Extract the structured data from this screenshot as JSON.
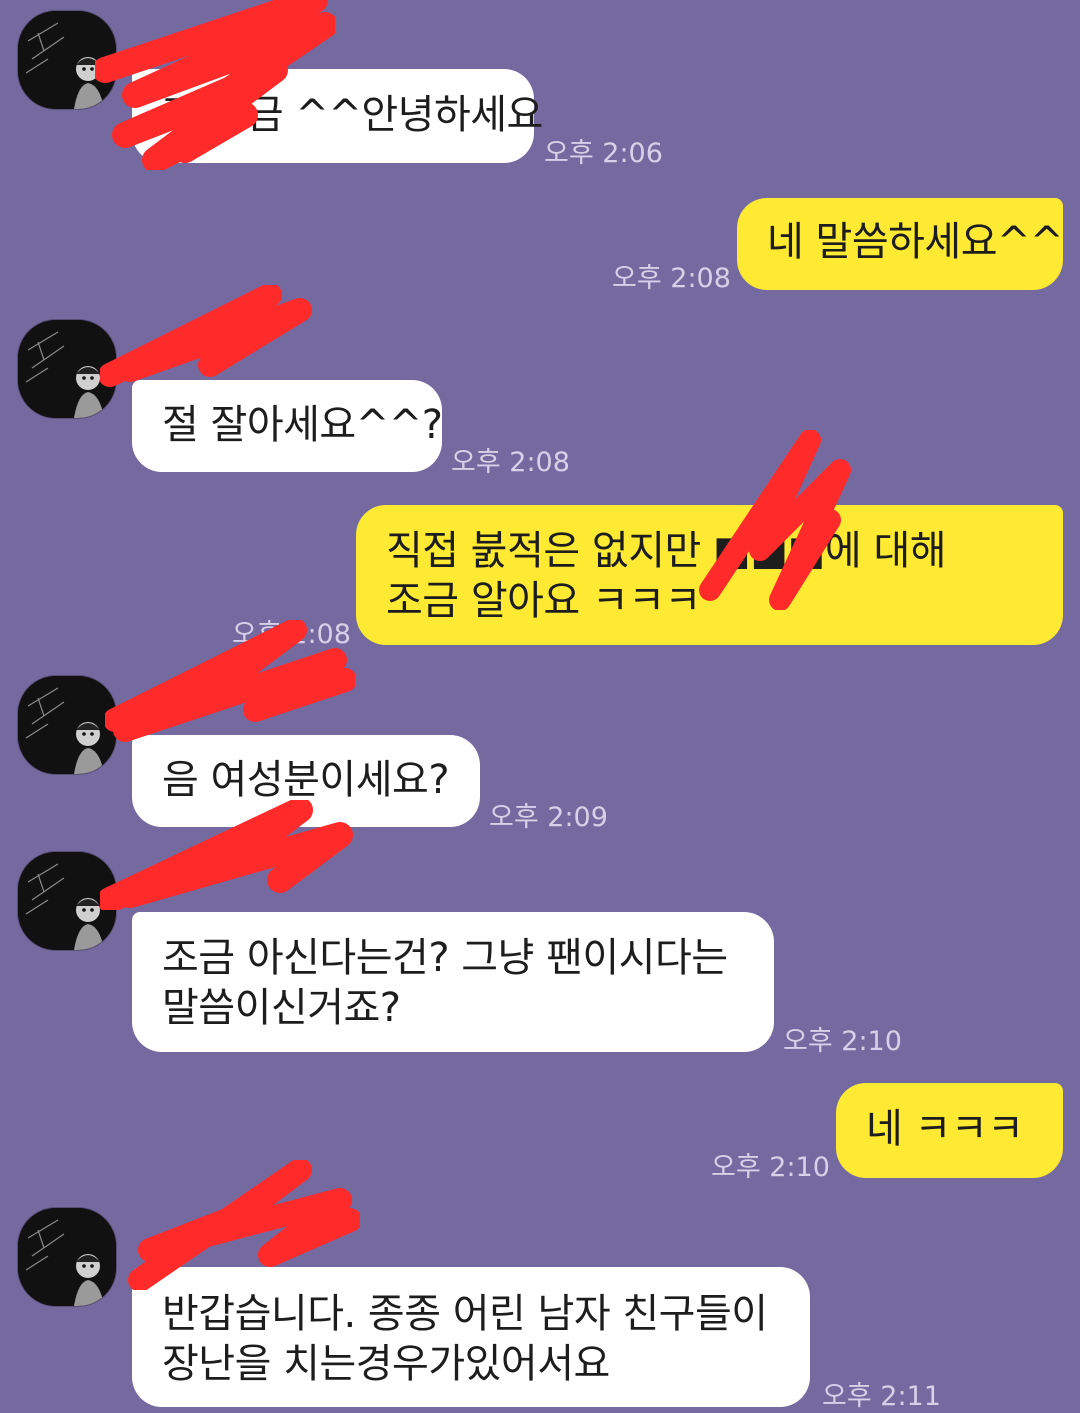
{
  "colors": {
    "background": "#746aa0",
    "incoming_bubble": "#ffffff",
    "outgoing_bubble": "#fee933",
    "timestamp": "#d6d1e8",
    "redaction": "#ff2a2a"
  },
  "messages": [
    {
      "from": "them",
      "lines": [
        "라 비금 ^^안녕하세요"
      ],
      "time": "오후 2:06"
    },
    {
      "from": "me",
      "lines": [
        "네 말씀하세요^^"
      ],
      "time": "오후 2:08"
    },
    {
      "from": "them",
      "lines": [
        "절 잘아세요^^?"
      ],
      "time": "오후 2:08"
    },
    {
      "from": "me",
      "lines": [
        "직접 붌적은 없지만 ■■■에 대해",
        "조금 알아요 ㅋㅋㅋ"
      ],
      "time": "오후 2:08"
    },
    {
      "from": "them",
      "lines": [
        "음 여성분이세요?"
      ],
      "time": "오후 2:09"
    },
    {
      "from": "them",
      "lines": [
        "조금 아신다는건? 그냥 팬이시다는",
        "말씀이신거죠?"
      ],
      "time": "오후 2:10"
    },
    {
      "from": "me",
      "lines": [
        "네 ㅋㅋㅋ"
      ],
      "time": "오후 2:10"
    },
    {
      "from": "them",
      "lines": [
        "반갑습니다. 종종 어린 남자 친구들이",
        "장난을 치는경우가있어서요"
      ],
      "time": "오후 2:11"
    }
  ]
}
